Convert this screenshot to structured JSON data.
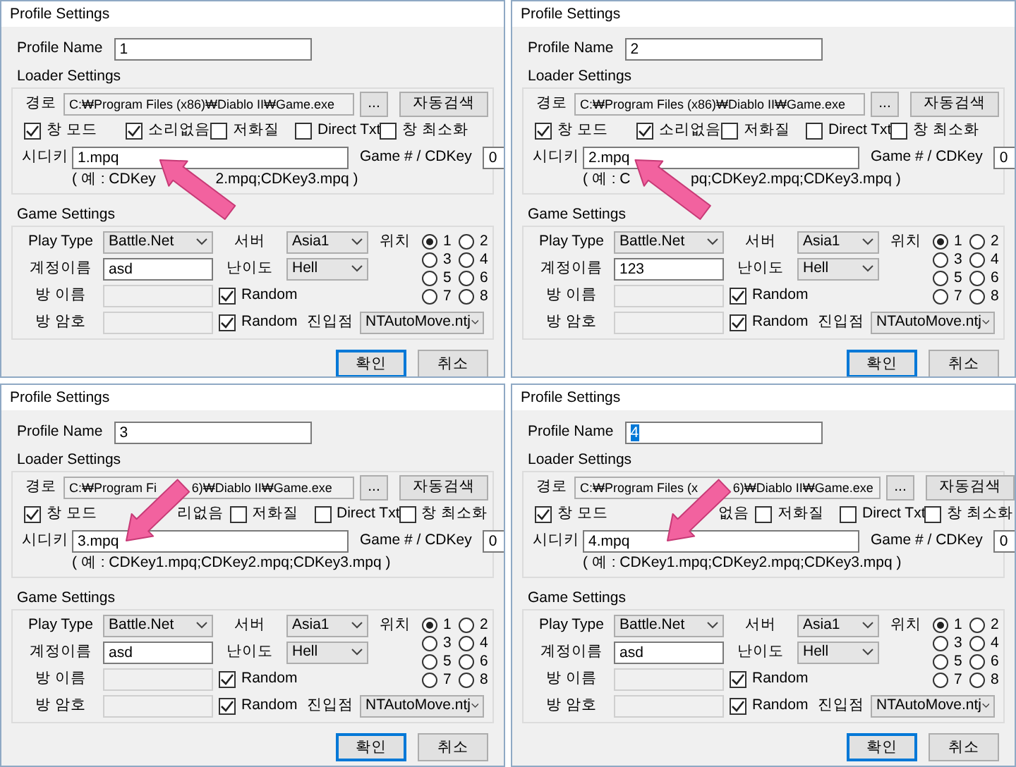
{
  "dialogs": [
    {
      "title": "Profile Settings",
      "profile": {
        "label": "Profile Name",
        "value": "1",
        "highlighted": false
      },
      "loader": {
        "title": "Loader Settings",
        "path_label": "경로",
        "path": [
          "C:₩Program Files (x86)₩Diablo II₩Game.exe"
        ],
        "browse_button": "...",
        "search_button": "자동검색",
        "options": [
          {
            "kind": "checkbox",
            "label": "창 모드",
            "checked": true
          },
          {
            "kind": "checkbox",
            "label": "소리없음",
            "checked": true
          },
          {
            "kind": "checkbox",
            "label": "저화질",
            "checked": false
          },
          {
            "kind": "checkbox",
            "label": "Direct Txt",
            "checked": false
          },
          {
            "kind": "checkbox",
            "label": "창 최소화",
            "checked": false
          }
        ],
        "cdkey_label": "시디키",
        "cdkey": "1.mpq",
        "game_number_label": "Game # / CDKey",
        "game_number": "0",
        "hint": [
          "( 예 : CDKey",
          "2.mpq;CDKey3.mpq )"
        ]
      },
      "game": {
        "title": "Game Settings",
        "play_type_label": "Play Type",
        "play_type": "Battle.Net",
        "server_label": "서버",
        "server": "Asia1",
        "slot_label": "위치",
        "slots": [
          {
            "label": "1",
            "selected": true
          },
          {
            "label": "2",
            "selected": false
          },
          {
            "label": "3",
            "selected": false
          },
          {
            "label": "4",
            "selected": false
          },
          {
            "label": "5",
            "selected": false
          },
          {
            "label": "6",
            "selected": false
          },
          {
            "label": "7",
            "selected": false
          },
          {
            "label": "8",
            "selected": false
          }
        ],
        "account_label": "계정이름",
        "account": "asd",
        "difficulty_label": "난이도",
        "difficulty": "Hell",
        "room_name_label": "방 이름",
        "room_name_disabled": true,
        "room_name_random": {
          "label": "Random",
          "checked": true
        },
        "room_password_label": "방 암호",
        "room_password_disabled": true,
        "room_password_random": {
          "label": "Random",
          "checked": true
        },
        "entry_label": "진입점",
        "entry": "NTAutoMove.ntj"
      },
      "buttons": [
        {
          "label": "확인",
          "default": true
        },
        {
          "label": "취소",
          "default": false
        }
      ],
      "annotation": {
        "kind": "arrow"
      }
    },
    {
      "title": "Profile Settings",
      "profile": {
        "label": "Profile Name",
        "value": "2",
        "highlighted": false
      },
      "loader": {
        "title": "Loader Settings",
        "path_label": "경로",
        "path": [
          "C:₩Program Files (x86)₩Diablo II₩Game.exe"
        ],
        "browse_button": "...",
        "search_button": "자동검색",
        "options": [
          {
            "kind": "checkbox",
            "label": "창 모드",
            "checked": true
          },
          {
            "kind": "checkbox",
            "label": "소리없음",
            "checked": true
          },
          {
            "kind": "checkbox",
            "label": "저화질",
            "checked": false
          },
          {
            "kind": "checkbox",
            "label": "Direct Txt",
            "checked": false
          },
          {
            "kind": "checkbox",
            "label": "창 최소화",
            "checked": false
          }
        ],
        "cdkey_label": "시디키",
        "cdkey": "2.mpq",
        "game_number_label": "Game # / CDKey",
        "game_number": "0",
        "hint": [
          "( 예 : C",
          "pq;CDKey2.mpq;CDKey3.mpq )"
        ]
      },
      "game": {
        "title": "Game Settings",
        "play_type_label": "Play Type",
        "play_type": "Battle.Net",
        "server_label": "서버",
        "server": "Asia1",
        "slot_label": "위치",
        "slots": [
          {
            "label": "1",
            "selected": true
          },
          {
            "label": "2",
            "selected": false
          },
          {
            "label": "3",
            "selected": false
          },
          {
            "label": "4",
            "selected": false
          },
          {
            "label": "5",
            "selected": false
          },
          {
            "label": "6",
            "selected": false
          },
          {
            "label": "7",
            "selected": false
          },
          {
            "label": "8",
            "selected": false
          }
        ],
        "account_label": "계정이름",
        "account": "123",
        "difficulty_label": "난이도",
        "difficulty": "Hell",
        "room_name_label": "방 이름",
        "room_name_disabled": true,
        "room_name_random": {
          "label": "Random",
          "checked": true
        },
        "room_password_label": "방 암호",
        "room_password_disabled": true,
        "room_password_random": {
          "label": "Random",
          "checked": true
        },
        "entry_label": "진입점",
        "entry": "NTAutoMove.ntj"
      },
      "buttons": [
        {
          "label": "확인",
          "default": true
        },
        {
          "label": "취소",
          "default": false
        }
      ],
      "annotation": {
        "kind": "arrow"
      }
    },
    {
      "title": "Profile Settings",
      "profile": {
        "label": "Profile Name",
        "value": "3",
        "highlighted": false
      },
      "loader": {
        "title": "Loader Settings",
        "path_label": "경로",
        "path": [
          "C:₩Program Fi",
          "6)₩Diablo II₩Game.exe"
        ],
        "browse_button": "...",
        "search_button": "자동검색",
        "options": [
          {
            "kind": "checkbox",
            "label": "창 모드",
            "checked": true
          },
          {
            "kind": "covered",
            "label": "리없음"
          },
          {
            "kind": "checkbox",
            "label": "저화질",
            "checked": false
          },
          {
            "kind": "checkbox",
            "label": "Direct Txt",
            "checked": false
          },
          {
            "kind": "checkbox",
            "label": "창 최소화",
            "checked": false
          }
        ],
        "cdkey_label": "시디키",
        "cdkey": "3.mpq",
        "game_number_label": "Game # / CDKey",
        "game_number": "0",
        "hint": [
          "( 예 : CDKey1.mpq;CDKey2.mpq;CDKey3.mpq )"
        ]
      },
      "game": {
        "title": "Game Settings",
        "play_type_label": "Play Type",
        "play_type": "Battle.Net",
        "server_label": "서버",
        "server": "Asia1",
        "slot_label": "위치",
        "slots": [
          {
            "label": "1",
            "selected": true
          },
          {
            "label": "2",
            "selected": false
          },
          {
            "label": "3",
            "selected": false
          },
          {
            "label": "4",
            "selected": false
          },
          {
            "label": "5",
            "selected": false
          },
          {
            "label": "6",
            "selected": false
          },
          {
            "label": "7",
            "selected": false
          },
          {
            "label": "8",
            "selected": false
          }
        ],
        "account_label": "계정이름",
        "account": "asd",
        "difficulty_label": "난이도",
        "difficulty": "Hell",
        "room_name_label": "방 이름",
        "room_name_disabled": true,
        "room_name_random": {
          "label": "Random",
          "checked": true
        },
        "room_password_label": "방 암호",
        "room_password_disabled": true,
        "room_password_random": {
          "label": "Random",
          "checked": true
        },
        "entry_label": "진입점",
        "entry": "NTAutoMove.ntj"
      },
      "buttons": [
        {
          "label": "확인",
          "default": true
        },
        {
          "label": "취소",
          "default": false
        }
      ],
      "annotation": {
        "kind": "arrow"
      }
    },
    {
      "title": "Profile Settings",
      "profile": {
        "label": "Profile Name",
        "value": "4",
        "highlighted": true
      },
      "loader": {
        "title": "Loader Settings",
        "path_label": "경로",
        "path": [
          "C:₩Program Files (x",
          "6)₩Diablo II₩Game.exe"
        ],
        "browse_button": "...",
        "search_button": "자동검색",
        "options": [
          {
            "kind": "checkbox",
            "label": "창 모드",
            "checked": true
          },
          {
            "kind": "covered",
            "label": "없음"
          },
          {
            "kind": "checkbox",
            "label": "저화질",
            "checked": false
          },
          {
            "kind": "checkbox",
            "label": "Direct Txt",
            "checked": false
          },
          {
            "kind": "checkbox",
            "label": "창 최소화",
            "checked": false
          }
        ],
        "cdkey_label": "시디키",
        "cdkey": "4.mpq",
        "game_number_label": "Game # / CDKey",
        "game_number": "0",
        "hint": [
          "( 예 : CDKey1.mpq;CDKey2.mpq;CDKey3.mpq )"
        ]
      },
      "game": {
        "title": "Game Settings",
        "play_type_label": "Play Type",
        "play_type": "Battle.Net",
        "server_label": "서버",
        "server": "Asia1",
        "slot_label": "위치",
        "slots": [
          {
            "label": "1",
            "selected": true
          },
          {
            "label": "2",
            "selected": false
          },
          {
            "label": "3",
            "selected": false
          },
          {
            "label": "4",
            "selected": false
          },
          {
            "label": "5",
            "selected": false
          },
          {
            "label": "6",
            "selected": false
          },
          {
            "label": "7",
            "selected": false
          },
          {
            "label": "8",
            "selected": false
          }
        ],
        "account_label": "계정이름",
        "account": "asd",
        "difficulty_label": "난이도",
        "difficulty": "Hell",
        "room_name_label": "방 이름",
        "room_name_disabled": true,
        "room_name_random": {
          "label": "Random",
          "checked": true
        },
        "room_password_label": "방 암호",
        "room_password_disabled": true,
        "room_password_random": {
          "label": "Random",
          "checked": true
        },
        "entry_label": "진입점",
        "entry": "NTAutoMove.ntj"
      },
      "buttons": [
        {
          "label": "확인",
          "default": true
        },
        {
          "label": "취소",
          "default": false
        }
      ],
      "annotation": {
        "kind": "arrow"
      }
    }
  ]
}
